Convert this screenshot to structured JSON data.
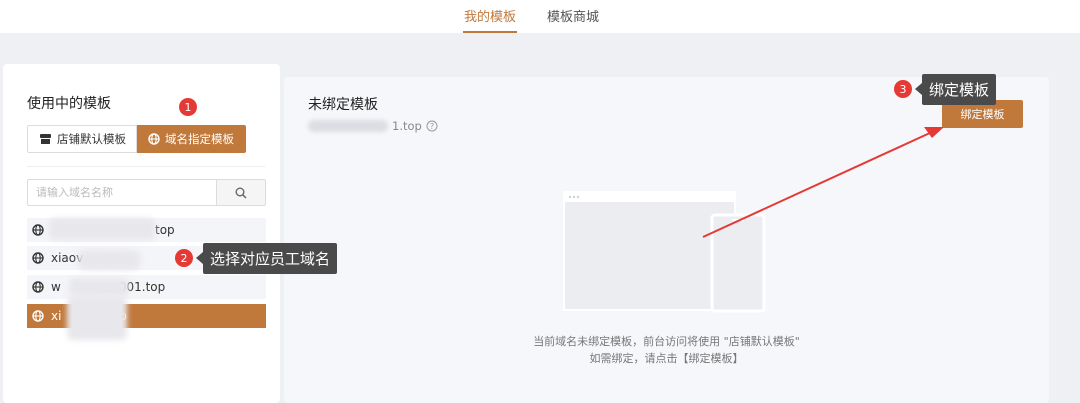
{
  "tabs": [
    {
      "label": "我的模板",
      "active": true
    },
    {
      "label": "模板商城",
      "active": false
    }
  ],
  "left_panel": {
    "title": "使用中的模板",
    "segments": [
      {
        "label": "店铺默认模板",
        "icon": "store-icon",
        "selected": false
      },
      {
        "label": "域名指定模板",
        "icon": "globe-icon",
        "selected": true
      }
    ],
    "search": {
      "placeholder": "请输入域名名称",
      "value": "",
      "icon": "search-icon"
    },
    "domains": [
      {
        "label": "top",
        "selected": false
      },
      {
        "label": "xiaov     op",
        "selected": false
      },
      {
        "label": "w          uer001.top",
        "selected": false
      },
      {
        "label": "xi         1.top",
        "selected": true
      }
    ]
  },
  "right_panel": {
    "title": "未绑定模板",
    "domain": "1.top",
    "help_icon": "question-circle-icon",
    "bind_button": "绑定模板",
    "message_line1": "当前域名未绑定模板，前台访问将使用 \"店铺默认模板\"",
    "message_line2": "如需绑定，请点击【绑定模板】"
  },
  "annotations": [
    {
      "number": "1",
      "text": ""
    },
    {
      "number": "2",
      "text": "选择对应员工域名"
    },
    {
      "number": "3",
      "text": "绑定模板"
    }
  ],
  "colors": {
    "accent": "#c0793b",
    "badge": "#e53935",
    "callout": "#4a4a4a",
    "arrow": "#e53935"
  }
}
